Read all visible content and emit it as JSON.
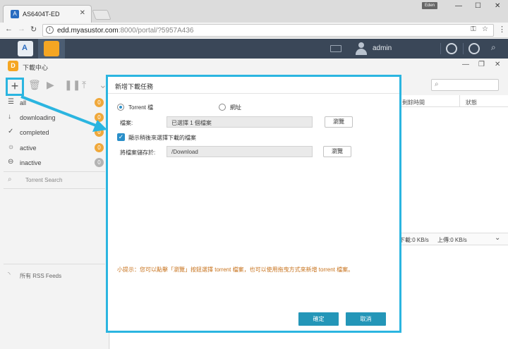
{
  "browser": {
    "tab_title": "AS6404T-ED",
    "profile_badge": "Eden",
    "url_host": "edd.myasustor.com",
    "url_rest": ":8000/portal/?5957A436"
  },
  "adm": {
    "username": "admin"
  },
  "app": {
    "title": "下載中心"
  },
  "sidebar": {
    "items": [
      {
        "label": "all",
        "count": "0",
        "icon": "list-icon",
        "color": "orange"
      },
      {
        "label": "downloading",
        "count": "0",
        "icon": "arrow-down-icon",
        "color": "orange"
      },
      {
        "label": "completed",
        "count": "0",
        "icon": "checkmark-icon",
        "color": "orange"
      },
      {
        "label": "active",
        "count": "0",
        "icon": "sun-icon",
        "color": "orange"
      },
      {
        "label": "inactive",
        "count": "0",
        "icon": "minus-circle-icon",
        "color": "gray"
      }
    ],
    "torrent_search": "Torrent Search",
    "rss_feeds": "所有 RSS Feeds"
  },
  "mainlist": {
    "col_remaining": "剩餘時間",
    "col_status": "狀態",
    "download_speed": "下載:0 KB/s",
    "upload_speed": "上傳:0 KB/s"
  },
  "dialog": {
    "title": "新增下載任務",
    "radio_torrent": "Torrent 檔",
    "radio_url": "網址",
    "file_label": "檔案:",
    "file_value": "已選擇 1 個檔案",
    "browse_label": "瀏覽",
    "checkbox_label": "顯示稍後來選擇下載的檔案",
    "save_label": "將檔案儲存於:",
    "save_value": "/Download",
    "hint": "小提示：您可以點擊「瀏覽」按鈕選擇 torrent 檔案，也可以使用拖曳方式來新增 torrent 檔案。",
    "ok_label": "確定",
    "cancel_label": "取消"
  },
  "colors": {
    "accent": "#2bb5e0",
    "button": "#2496b8",
    "hint": "#c7721c",
    "badge_orange": "#f0a83a"
  }
}
